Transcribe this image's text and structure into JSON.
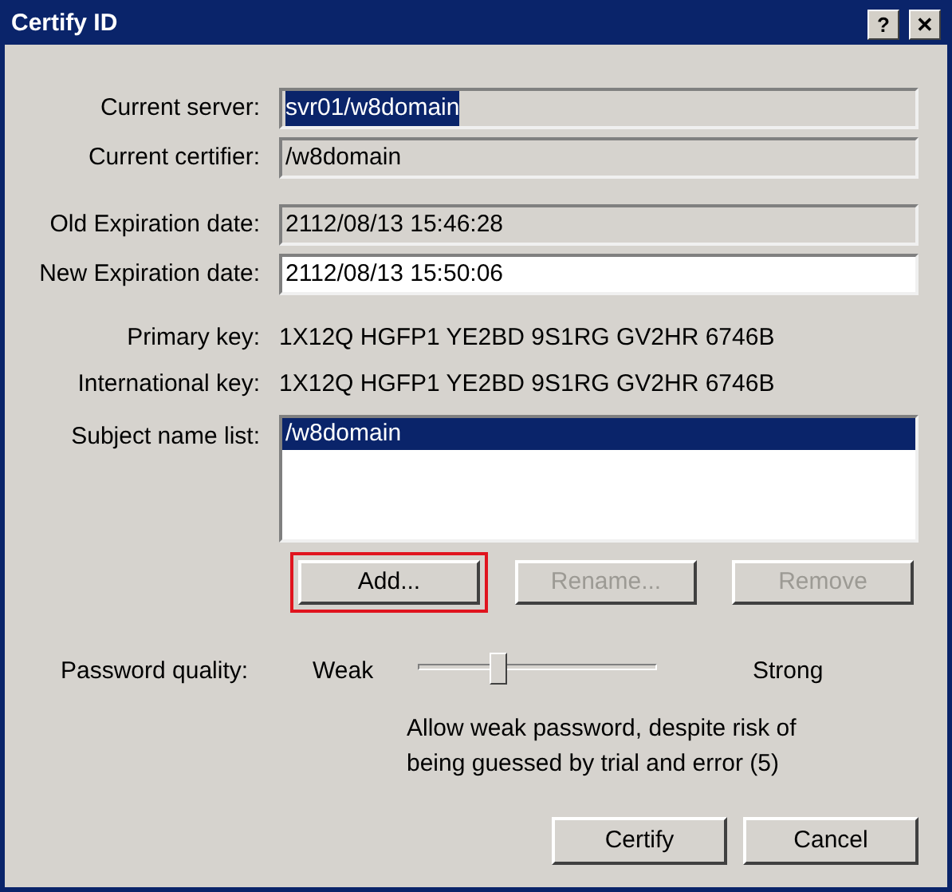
{
  "window": {
    "title": "Certify ID",
    "title_buttons": [
      "?",
      "✕"
    ]
  },
  "fields": [
    {
      "label": "Current server:",
      "value": "svr01/w8domain",
      "editable": false,
      "selected": true,
      "gap_before": false
    },
    {
      "label": "Current certifier:",
      "value": "/w8domain",
      "editable": false,
      "selected": false,
      "gap_before": false
    },
    {
      "label": "Old Expiration date:",
      "value": "2112/08/13 15:46:28",
      "editable": false,
      "selected": false,
      "gap_before": true
    },
    {
      "label": "New Expiration date:",
      "value": "2112/08/13 15:50:06",
      "editable": true,
      "selected": false,
      "gap_before": false
    }
  ],
  "keys": [
    {
      "label": "Primary key:",
      "value": "1X12Q HGFP1 YE2BD 9S1RG GV2HR 6746B"
    },
    {
      "label": "International key:",
      "value": "1X12Q HGFP1 YE2BD 9S1RG GV2HR 6746B"
    }
  ],
  "subject_list": {
    "label": "Subject name list:",
    "items": [
      {
        "text": "/w8domain",
        "selected": true
      }
    ]
  },
  "list_buttons": [
    {
      "label": "Add...",
      "disabled": false,
      "highlighted": true
    },
    {
      "label": "Rename...",
      "disabled": true,
      "highlighted": false
    },
    {
      "label": "Remove",
      "disabled": true,
      "highlighted": false
    }
  ],
  "password_quality": {
    "label": "Password quality:",
    "low": "Weak",
    "high": "Strong",
    "level": 0.33,
    "note": "Allow weak password, despite risk of being guessed by trial and error (5)"
  },
  "buttons": [
    {
      "label": "Certify"
    },
    {
      "label": "Cancel"
    }
  ]
}
